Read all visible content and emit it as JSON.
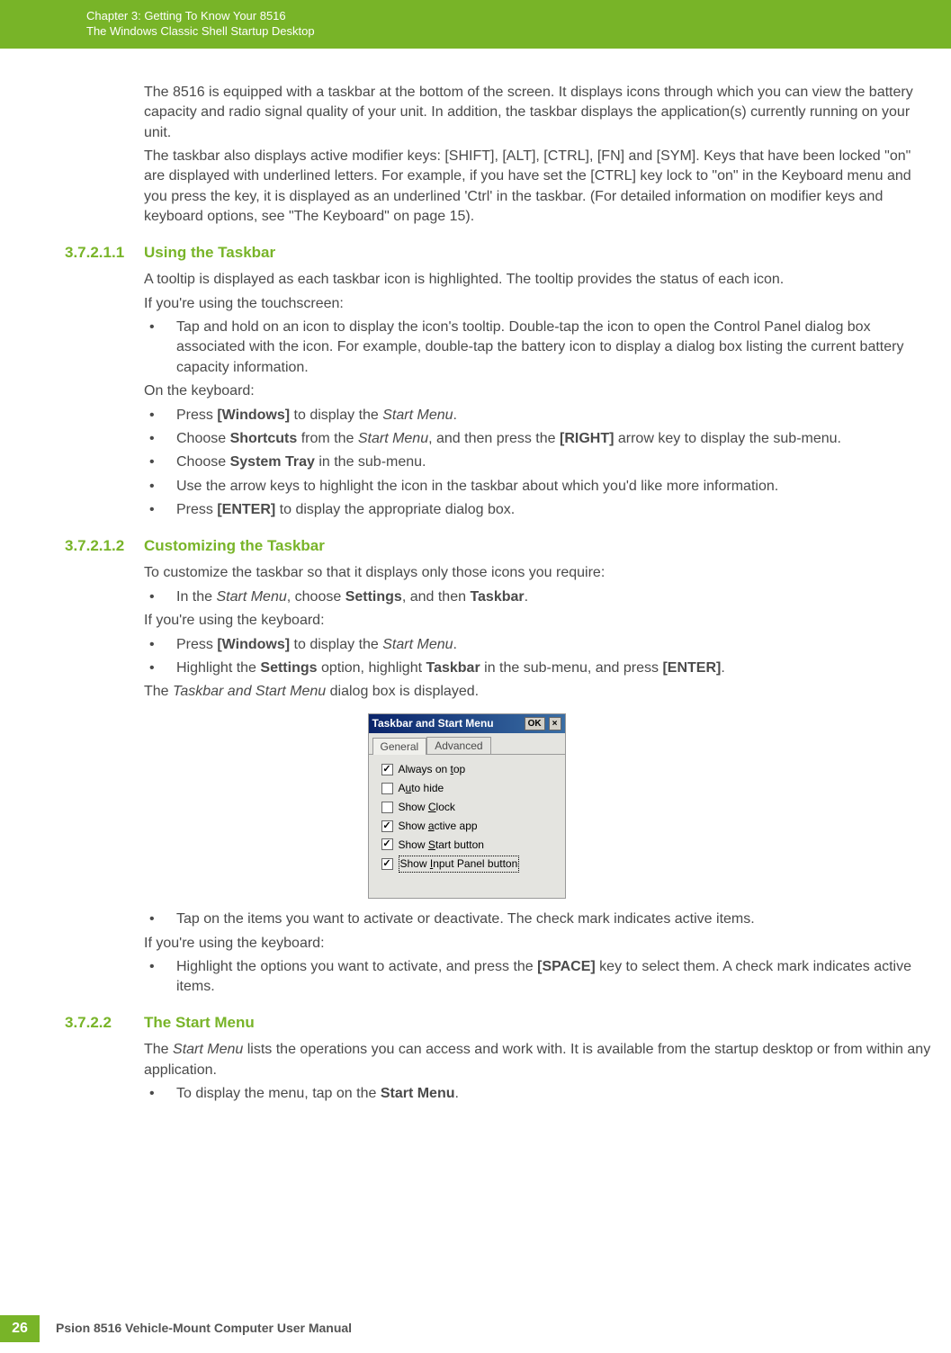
{
  "header": {
    "chapter": "Chapter 3:  Getting To Know Your 8516",
    "subtitle": "The Windows Classic Shell Startup Desktop"
  },
  "intro": {
    "p1": "The 8516 is equipped with a taskbar at the bottom of the screen. It displays icons through which you can view the battery capacity and radio signal quality of your unit. In addition, the taskbar displays the application(s) currently running on your unit.",
    "p2a": "The taskbar also displays active modifier keys: [SHIFT], [ALT], [CTRL], [FN] and [SYM]. Keys that have been locked \"on\" are displayed with underlined letters. For example, if you have set the [CTRL] key lock to \"on\" in the Keyboard menu and you press the key, it is displayed as an underlined 'Ctrl' in the taskbar. (For detailed information on modifier keys and keyboard options, see \"The Keyboard\" on page 15)."
  },
  "s1": {
    "num": "3.7.2.1.1",
    "title": "Using the Taskbar",
    "p1": "A tooltip is displayed as each taskbar icon is highlighted. The tooltip provides the status of each icon.",
    "p2": "If you're using the touchscreen:",
    "b1": "Tap and hold on an icon to display the icon's tooltip. Double-tap the icon to open the Control Panel dialog box associated with the icon. For example, double-tap the battery icon to display a dialog box listing the current battery capacity information.",
    "p3": "On the keyboard:",
    "b2_pre": "Press ",
    "b2_bold": "[Windows]",
    "b2_mid": " to display the ",
    "b2_it": "Start Menu",
    "b2_post": ".",
    "b3_pre": "Choose ",
    "b3_bold1": "Shortcuts",
    "b3_mid1": " from the ",
    "b3_it": "Start Menu",
    "b3_mid2": ", and then press the ",
    "b3_bold2": "[RIGHT]",
    "b3_post": " arrow key to display the sub-menu.",
    "b4_pre": "Choose ",
    "b4_bold": "System Tray",
    "b4_post": " in the sub-menu.",
    "b5": "Use the arrow keys to highlight the icon in the taskbar about which you'd like more information.",
    "b6_pre": "Press ",
    "b6_bold": "[ENTER]",
    "b6_post": " to display the appropriate dialog box."
  },
  "s2": {
    "num": "3.7.2.1.2",
    "title": "Customizing the Taskbar",
    "p1": "To customize the taskbar so that it displays only those icons you require:",
    "b1_pre": "In the ",
    "b1_it": "Start Menu",
    "b1_mid": ", choose ",
    "b1_bold1": "Settings",
    "b1_mid2": ", and then ",
    "b1_bold2": "Taskbar",
    "b1_post": ".",
    "p2": "If you're using the keyboard:",
    "b2_pre": "Press ",
    "b2_bold": "[Windows]",
    "b2_mid": " to display the ",
    "b2_it": "Start Menu",
    "b2_post": ".",
    "b3_pre": "Highlight the ",
    "b3_bold1": "Settings",
    "b3_mid1": " option, highlight ",
    "b3_bold2": "Taskbar",
    "b3_mid2": " in the sub-menu, and press ",
    "b3_bold3": "[ENTER]",
    "b3_post": ".",
    "p3_pre": "The ",
    "p3_it": "Taskbar and Start Menu",
    "p3_post": " dialog box is displayed.",
    "b4": "Tap on the items you want to activate or deactivate. The check mark indicates active items.",
    "p4": "If you're using the keyboard:",
    "b5_pre": "Highlight the options you want to activate, and press the ",
    "b5_bold": "[SPACE]",
    "b5_post": " key to select them. A check mark indicates active items."
  },
  "dialog": {
    "title": "Taskbar and Start Menu",
    "ok": "OK",
    "close": "×",
    "tab1": "General",
    "tab2": "Advanced",
    "opts": [
      {
        "pre": "Always on ",
        "ul": "t",
        "post": "op",
        "checked": true,
        "focused": false
      },
      {
        "pre": "A",
        "ul": "u",
        "post": "to hide",
        "checked": false,
        "focused": false
      },
      {
        "pre": "Show ",
        "ul": "C",
        "post": "lock",
        "checked": false,
        "focused": false
      },
      {
        "pre": "Show ",
        "ul": "a",
        "post": "ctive app",
        "checked": true,
        "focused": false
      },
      {
        "pre": "Show ",
        "ul": "S",
        "post": "tart button",
        "checked": true,
        "focused": false
      },
      {
        "pre": "Show ",
        "ul": "I",
        "post": "nput Panel button",
        "checked": true,
        "focused": true
      }
    ]
  },
  "s3": {
    "num": "3.7.2.2",
    "title": "The Start Menu",
    "p1_pre": "The ",
    "p1_it": "Start Menu",
    "p1_post": " lists the operations you can access and work with. It is available from the startup desktop or from within any application.",
    "b1_pre": "To display the menu, tap on the ",
    "b1_bold": "Start Menu",
    "b1_post": "."
  },
  "footer": {
    "page": "26",
    "text": "Psion 8516 Vehicle-Mount Computer User Manual"
  }
}
